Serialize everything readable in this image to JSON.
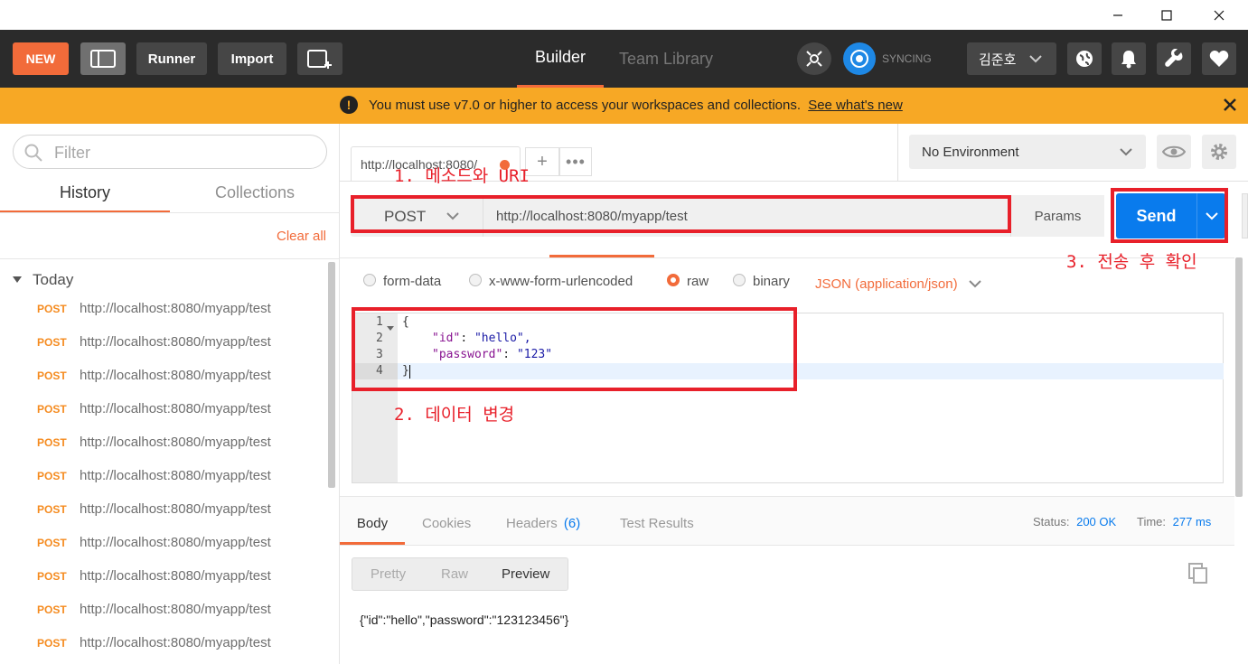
{
  "header": {
    "new_label": "NEW",
    "runner_label": "Runner",
    "import_label": "Import",
    "tab_builder": "Builder",
    "tab_team_library": "Team Library",
    "sync_status": "SYNCING",
    "user_name": "김준호"
  },
  "banner": {
    "message": "You must use v7.0 or higher to access your workspaces and collections.",
    "link": "See what's new"
  },
  "sidebar": {
    "filter_placeholder": "Filter",
    "tab_history": "History",
    "tab_collections": "Collections",
    "clear_all": "Clear all",
    "group_label": "Today",
    "items": [
      {
        "method": "POST",
        "url": "http://localhost:8080/myapp/test"
      },
      {
        "method": "POST",
        "url": "http://localhost:8080/myapp/test"
      },
      {
        "method": "POST",
        "url": "http://localhost:8080/myapp/test"
      },
      {
        "method": "POST",
        "url": "http://localhost:8080/myapp/test"
      },
      {
        "method": "POST",
        "url": "http://localhost:8080/myapp/test"
      },
      {
        "method": "POST",
        "url": "http://localhost:8080/myapp/test"
      },
      {
        "method": "POST",
        "url": "http://localhost:8080/myapp/test"
      },
      {
        "method": "POST",
        "url": "http://localhost:8080/myapp/test"
      },
      {
        "method": "POST",
        "url": "http://localhost:8080/myapp/test"
      },
      {
        "method": "POST",
        "url": "http://localhost:8080/myapp/test"
      },
      {
        "method": "POST",
        "url": "http://localhost:8080/myapp/test"
      }
    ]
  },
  "request": {
    "tab_title": "http://localhost:8080/",
    "environment": "No Environment",
    "method": "POST",
    "url": "http://localhost:8080/myapp/test",
    "params_label": "Params",
    "send_label": "Send",
    "body_types": [
      "form-data",
      "x-www-form-urlencoded",
      "raw",
      "binary"
    ],
    "content_type": "JSON (application/json)",
    "code_lines": [
      {
        "num": "1",
        "text": "{"
      },
      {
        "num": "2",
        "key": "\"id\"",
        "value": "\"hello\","
      },
      {
        "num": "3",
        "key": "\"password\"",
        "value": "\"123\""
      },
      {
        "num": "4",
        "text": "}"
      }
    ]
  },
  "response": {
    "tabs": [
      "Body",
      "Cookies",
      "Headers",
      "Test Results"
    ],
    "headers_count": "(6)",
    "status_label": "Status:",
    "status_value": "200 OK",
    "time_label": "Time:",
    "time_value": "277 ms",
    "view_modes": [
      "Pretty",
      "Raw",
      "Preview"
    ],
    "body_text": "{\"id\":\"hello\",\"password\":\"123123456\"}"
  },
  "annotations": {
    "step1": "1. 메소드와 URI",
    "step2": "2. 데이터 변경",
    "step3": "3. 전송 후 확인"
  },
  "colors": {
    "accent_orange": "#f26b3a",
    "send_blue": "#097bed",
    "banner_yellow": "#f7a825",
    "annotation_red": "#e8202a",
    "header_dark": "#2b2b2b"
  }
}
